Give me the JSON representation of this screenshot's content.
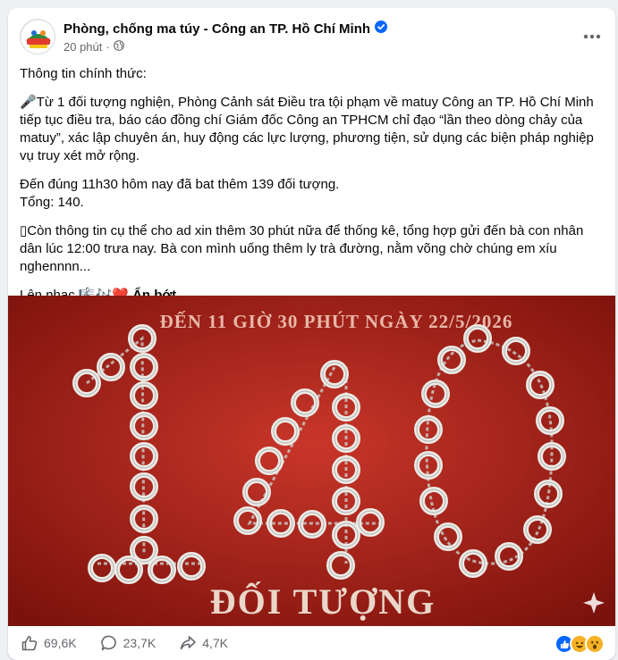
{
  "post": {
    "page_name": "Phòng, chống ma túy - Công an TP. Hồ Chí Minh",
    "time": "20 phút",
    "time_separator": "·",
    "paragraphs": [
      "Thông tin chính thức:",
      "🎤Từ 1 đối tượng nghiện, Phòng Cảnh sát Điều tra tội phạm về matuy Công an TP. Hồ Chí Minh tiếp tục điều tra, báo cáo đồng chí Giám đốc Công an TPHCM chỉ đạo “lần theo dòng chảy của matuy”, xác lập chuyên án, huy động các lực lượng, phương tiện, sử dụng các biện pháp nghiệp vụ truy xét mở rộng.",
      "Đến đúng 11h30 hôm nay đã bat thêm 139 đối tượng.",
      "Tổng: 140.",
      "Còn thông tin cụ thể cho ad xin thêm 30 phút nữa để thống kê, tổng hợp gửi đến bà con nhân dân lúc 12:00 trưa nay. Bà con mình uống thêm ly trà đường, nằm võng chờ chúng em xíu nghennnn...",
      "Lên nhạc 🎼🎶❤️"
    ],
    "see_less": "Ẩn bớt",
    "image_header": "ĐẾN 11 GIỜ 30 PHÚT NGÀY 22/5/2026",
    "image_number": "140",
    "image_caption": "ĐỐI TƯỢNG",
    "likes": "69,6K",
    "comments": "23,7K",
    "shares": "4,7K"
  },
  "icons": {
    "verified": "verified-badge-icon",
    "privacy": "globe-icon",
    "more": "more-options-icon",
    "like": "like-icon",
    "comment": "comment-icon",
    "share": "share-icon"
  },
  "colors": {
    "accent": "#0866ff",
    "image_background": "#b0261c",
    "secondary_text": "#65686c"
  }
}
